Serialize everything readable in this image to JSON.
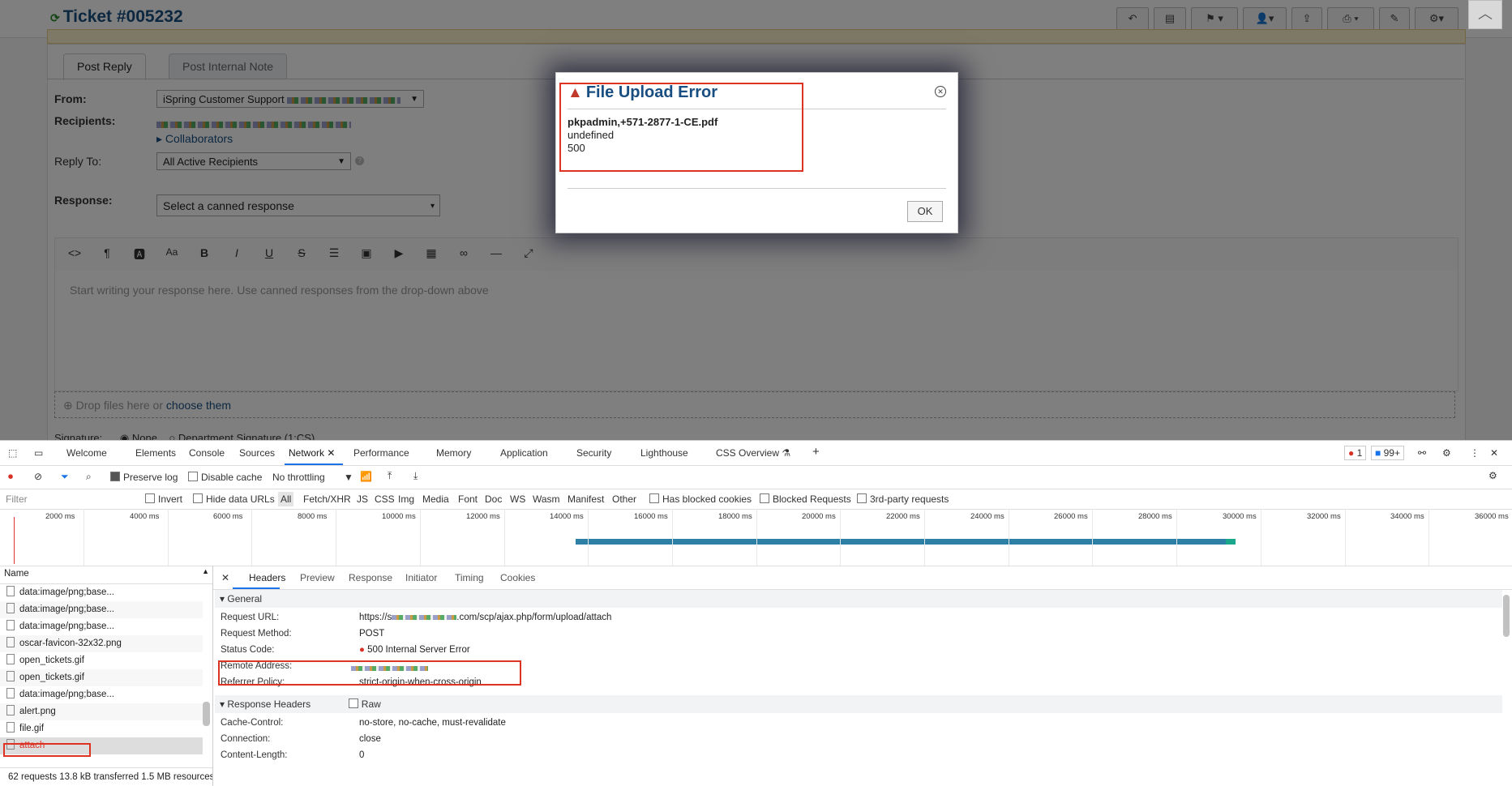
{
  "app": {
    "ticket_title": "Ticket #005232",
    "tabs": {
      "post_reply": "Post Reply",
      "internal_note": "Post Internal Note"
    },
    "from_label": "From:",
    "from_value": "iSpring Customer Support",
    "recipients_label": "Recipients:",
    "collaborators": "Collaborators",
    "reply_to_label": "Reply To:",
    "reply_to_value": "All Active Recipients",
    "response_label": "Response:",
    "response_placeholder": "Select a canned response",
    "editor_placeholder": "Start writing your response here. Use canned responses from the drop-down above",
    "dropzone_text": "Drop files here or",
    "dropzone_link": "choose them",
    "signature_label": "Signature:",
    "signature_option_none": "None",
    "signature_option_dept": "Department Signature (1:CS)"
  },
  "dialog": {
    "title": "File Upload Error",
    "filename": "pkpadmin,+571-2877-1-CE.pdf",
    "line2": "undefined",
    "line3": "500",
    "ok_label": "OK"
  },
  "devtools": {
    "tabs": [
      "Welcome",
      "Elements",
      "Console",
      "Sources",
      "Network",
      "Performance",
      "Memory",
      "Application",
      "Security",
      "Lighthouse",
      "CSS Overview"
    ],
    "active_tab": "Network",
    "error_count": "1",
    "message_count": "99+",
    "preserve_log": "Preserve log",
    "disable_cache": "Disable cache",
    "throttling": "No throttling",
    "filter_placeholder": "Filter",
    "invert": "Invert",
    "hide_data_urls": "Hide data URLs",
    "type_filters": [
      "All",
      "Fetch/XHR",
      "JS",
      "CSS",
      "Img",
      "Media",
      "Font",
      "Doc",
      "WS",
      "Wasm",
      "Manifest",
      "Other"
    ],
    "has_blocked_cookies": "Has blocked cookies",
    "blocked_requests": "Blocked Requests",
    "third_party": "3rd-party requests",
    "timeline_ticks": [
      "2000 ms",
      "4000 ms",
      "6000 ms",
      "8000 ms",
      "10000 ms",
      "12000 ms",
      "14000 ms",
      "16000 ms",
      "18000 ms",
      "20000 ms",
      "22000 ms",
      "24000 ms",
      "26000 ms",
      "28000 ms",
      "30000 ms",
      "32000 ms",
      "34000 ms",
      "36000 ms"
    ],
    "name_header": "Name",
    "requests": [
      "data:image/png;base...",
      "data:image/png;base...",
      "data:image/png;base...",
      "oscar-favicon-32x32.png",
      "open_tickets.gif",
      "open_tickets.gif",
      "data:image/png;base...",
      "alert.png",
      "file.gif",
      "attach"
    ],
    "footer": "62 requests  13.8 kB transferred  1.5 MB resources",
    "detail_tabs": [
      "Headers",
      "Preview",
      "Response",
      "Initiator",
      "Timing",
      "Cookies"
    ],
    "general": {
      "heading": "General",
      "request_url_label": "Request URL:",
      "request_url_prefix": "https://s",
      "request_url_suffix": ".com/scp/ajax.php/form/upload/attach",
      "request_method_label": "Request Method:",
      "request_method": "POST",
      "status_code_label": "Status Code:",
      "status_code": "500 Internal Server Error",
      "remote_address_label": "Remote Address:",
      "referrer_policy_label": "Referrer Policy:",
      "referrer_policy": "strict-origin-when-cross-origin"
    },
    "response_headers": {
      "heading": "Response Headers",
      "raw_label": "Raw",
      "cache_control_label": "Cache-Control:",
      "cache_control": "no-store, no-cache, must-revalidate",
      "connection_label": "Connection:",
      "connection": "close",
      "content_length_label": "Content-Length:",
      "content_length": "0"
    },
    "colors": {
      "accent": "#1a73e8",
      "error": "#d93025",
      "highlight": "#d32f2f"
    }
  }
}
